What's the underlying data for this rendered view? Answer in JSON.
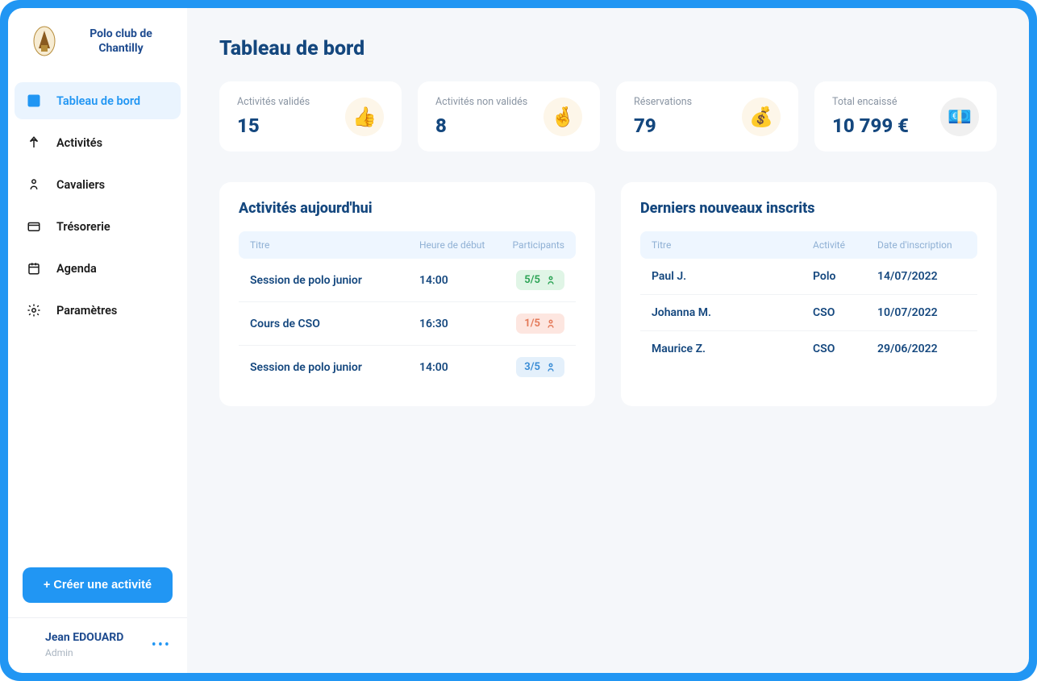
{
  "brand": "Polo club de Chantilly",
  "nav": {
    "dashboard": "Tableau de bord",
    "activities": "Activités",
    "riders": "Cavaliers",
    "treasury": "Trésorerie",
    "agenda": "Agenda",
    "settings": "Paramètres"
  },
  "create_button": "+ Créer une activité",
  "user": {
    "name": "Jean EDOUARD",
    "role": "Admin"
  },
  "page_title": "Tableau de bord",
  "stats": {
    "validated": {
      "label": "Activités validés",
      "value": "15",
      "emoji": "👍"
    },
    "not_validated": {
      "label": "Activités non validés",
      "value": "8",
      "emoji": "🤞"
    },
    "reservations": {
      "label": "Réservations",
      "value": "79",
      "emoji": "💰"
    },
    "total": {
      "label": "Total encaissé",
      "value": "10 799 €",
      "emoji": "💶"
    }
  },
  "today": {
    "title": "Activités aujourd'hui",
    "headers": {
      "title": "Titre",
      "start": "Heure de début",
      "participants": "Participants"
    },
    "rows": [
      {
        "title": "Session de polo junior",
        "start": "14:00",
        "participants": "5/5",
        "tone": "green"
      },
      {
        "title": "Cours de CSO",
        "start": "16:30",
        "participants": "1/5",
        "tone": "red"
      },
      {
        "title": "Session de polo junior",
        "start": "14:00",
        "participants": "3/5",
        "tone": "blue"
      }
    ]
  },
  "signups": {
    "title": "Derniers nouveaux inscrits",
    "headers": {
      "title": "Titre",
      "activity": "Activité",
      "date": "Date d'inscription"
    },
    "rows": [
      {
        "name": "Paul J.",
        "activity": "Polo",
        "date": "14/07/2022"
      },
      {
        "name": "Johanna M.",
        "activity": "CSO",
        "date": "10/07/2022"
      },
      {
        "name": "Maurice Z.",
        "activity": "CSO",
        "date": "29/06/2022"
      }
    ]
  }
}
